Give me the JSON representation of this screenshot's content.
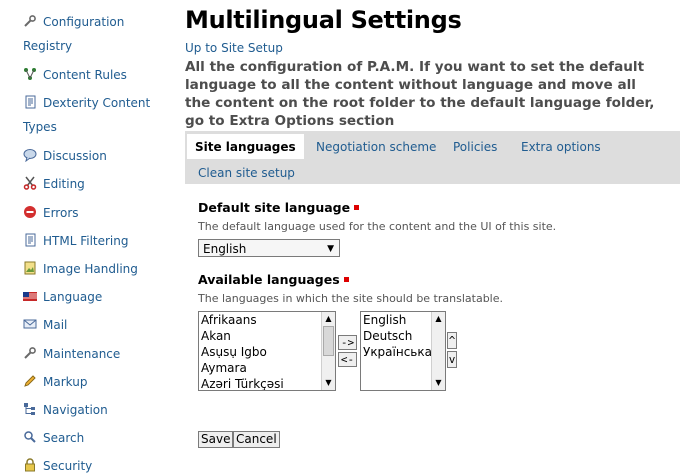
{
  "sidebar": {
    "items": [
      {
        "label": "Configuration",
        "continuation": "Registry",
        "icon": "wrench-icon"
      },
      {
        "label": "Content Rules",
        "icon": "content-rules-icon"
      },
      {
        "label": "Dexterity Content",
        "continuation": "Types",
        "icon": "document-icon"
      },
      {
        "label": "Discussion",
        "icon": "speech-bubble-icon"
      },
      {
        "label": "Editing",
        "icon": "scissors-icon"
      },
      {
        "label": "Errors",
        "icon": "error-icon"
      },
      {
        "label": "HTML Filtering",
        "icon": "document-icon"
      },
      {
        "label": "Image Handling",
        "icon": "image-icon"
      },
      {
        "label": "Language",
        "icon": "flag-icon"
      },
      {
        "label": "Mail",
        "icon": "mail-icon"
      },
      {
        "label": "Maintenance",
        "icon": "wrench-icon"
      },
      {
        "label": "Markup",
        "icon": "pencil-icon"
      },
      {
        "label": "Navigation",
        "icon": "navigation-icon"
      },
      {
        "label": "Search",
        "icon": "search-icon"
      },
      {
        "label": "Security",
        "icon": "lock-icon"
      }
    ]
  },
  "page": {
    "title": "Multilingual Settings",
    "up_link": "Up to Site Setup",
    "description": "All the configuration of P.A.M. If you want to set the default language to all the content without language and move all the content on the root folder to the default language folder, go to Extra Options section"
  },
  "tabs": [
    {
      "label": "Site languages",
      "active": true
    },
    {
      "label": "Negotiation scheme",
      "active": false
    },
    {
      "label": "Policies",
      "active": false
    },
    {
      "label": "Extra options",
      "active": false
    },
    {
      "label": "Clean site setup",
      "active": false
    }
  ],
  "form": {
    "default_language": {
      "label": "Default site language",
      "help": "The default language used for the content and the UI of this site.",
      "value": "English"
    },
    "available_languages": {
      "label": "Available languages",
      "help": "The languages in which the site should be translatable.",
      "from_options": [
        "Afrikaans",
        "Akan",
        "Asụsụ Igbo",
        "Aymara",
        "Azəri Türkçəsi"
      ],
      "to_options": [
        "English",
        "Deutsch",
        "Українська"
      ],
      "add_label": "->",
      "remove_label": "<-",
      "up_label": "^",
      "down_label": "v"
    },
    "save_label": "Save",
    "cancel_label": "Cancel"
  },
  "colors": {
    "link": "#205c90",
    "tabbar": "#dddddd",
    "required": "#dd0000"
  }
}
